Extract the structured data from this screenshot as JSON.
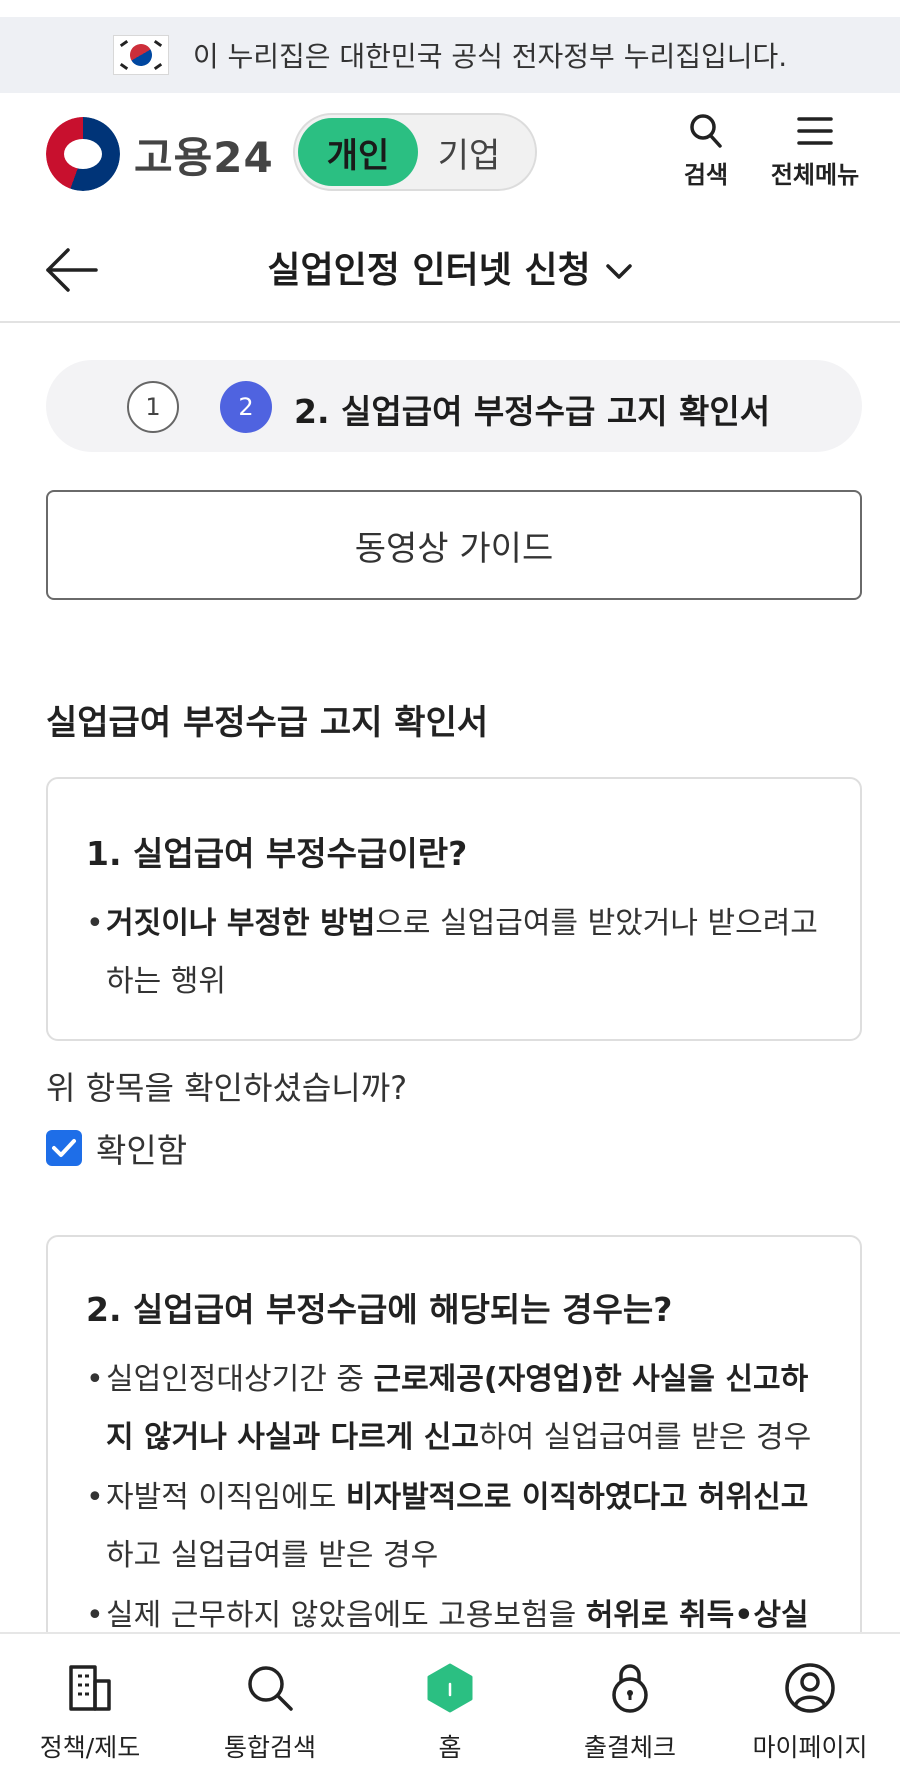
{
  "gov_banner": {
    "text": "이 누리집은 대한민국 공식 전자정부 누리집입니다."
  },
  "header": {
    "logo_text": "고용24",
    "toggle": {
      "active": "개인",
      "inactive": "기업"
    },
    "search_label": "검색",
    "menu_label": "전체메뉴"
  },
  "title_bar": {
    "title": "실업인정 인터넷 신청"
  },
  "stepper": {
    "done_step": "1",
    "current_step": "2",
    "current_label": "2. 실업급여 부정수급 고지 확인서"
  },
  "video_guide_label": "동영상 가이드",
  "section_heading": "실업급여 부정수급 고지 확인서",
  "card1": {
    "title": "1. 실업급여 부정수급이란?",
    "bullet_bold": "거짓이나 부정한 방법",
    "bullet_rest": "으로 실업급여를 받았거나 받으려고 하는 행위"
  },
  "confirm": {
    "question": "위 항목을 확인하셨습니까?",
    "checkbox_label": "확인함",
    "checked": true
  },
  "card2": {
    "title": "2. 실업급여 부정수급에 해당되는 경우는?",
    "b1_pre": "실업인정대상기간 중 ",
    "b1_bold": "근로제공(자영업)한 사실을 신고하지 않거나 사실과 다르게 신고",
    "b1_post": "하여 실업급여를 받은 경우",
    "b2_pre": "자발적 이직임에도 ",
    "b2_bold": "비자발적으로 이직하였다고 허위신고",
    "b2_post": "하고 실업급여를 받은 경우",
    "b3_pre": "실제 근무하지 않았음에도 고용보험을 ",
    "b3_bold": "허위로 취득•상실"
  },
  "bottom_nav": {
    "items": [
      {
        "label": "정책/제도",
        "icon": "building-icon"
      },
      {
        "label": "통합검색",
        "icon": "search-icon"
      },
      {
        "label": "홈",
        "icon": "home-icon"
      },
      {
        "label": "출결체크",
        "icon": "lock-icon"
      },
      {
        "label": "마이페이지",
        "icon": "user-icon"
      }
    ]
  },
  "colors": {
    "toggle_active": "#2bbf82",
    "step_current": "#4f63e0",
    "checkbox": "#1e6ee8"
  }
}
